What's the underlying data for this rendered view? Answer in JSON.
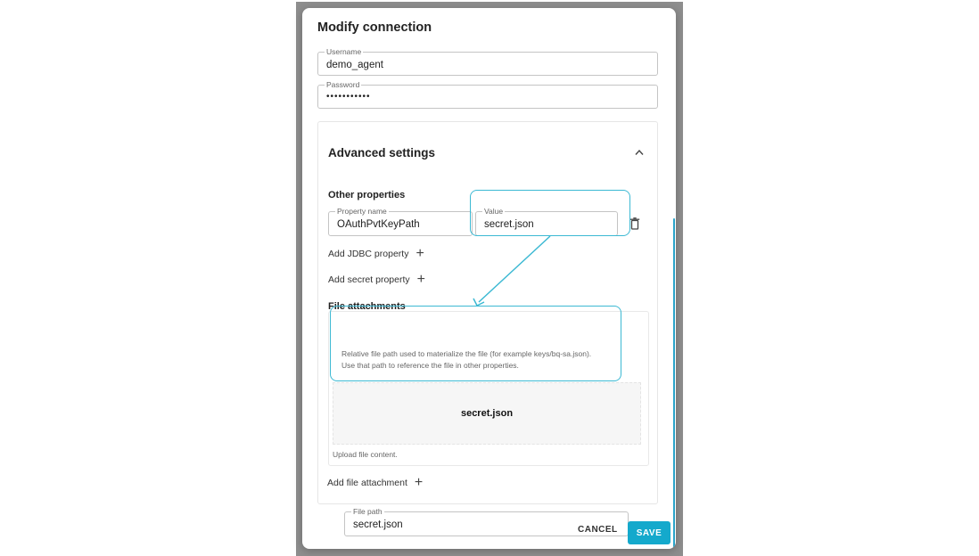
{
  "dialog": {
    "title": "Modify connection",
    "username": {
      "label": "Username",
      "value": "demo_agent"
    },
    "password": {
      "label": "Password",
      "value": "•••••••••••"
    },
    "advanced": {
      "title": "Advanced settings",
      "other_properties_heading": "Other properties",
      "property": {
        "name_label": "Property name",
        "name_value": "OAuthPvtKeyPath",
        "value_label": "Value",
        "value_value": "secret.json"
      },
      "add_jdbc_label": "Add JDBC property",
      "add_secret_label": "Add secret property",
      "file_attachments_heading": "File attachments",
      "attachment": {
        "path_label": "File path",
        "path_value": "secret.json",
        "help_text": "Relative file path used to materialize the file (for example keys/bq-sa.json). Use that path to reference the file in other properties.",
        "file_name": "secret.json",
        "upload_hint": "Upload file content."
      },
      "add_file_label": "Add file attachment"
    },
    "actions": {
      "cancel": "CANCEL",
      "save": "SAVE"
    }
  },
  "colors": {
    "accent": "#14a9cc",
    "highlight": "#3cb9d3"
  },
  "icons": [
    "chevron-up-icon",
    "trash-icon",
    "plus-icon"
  ]
}
